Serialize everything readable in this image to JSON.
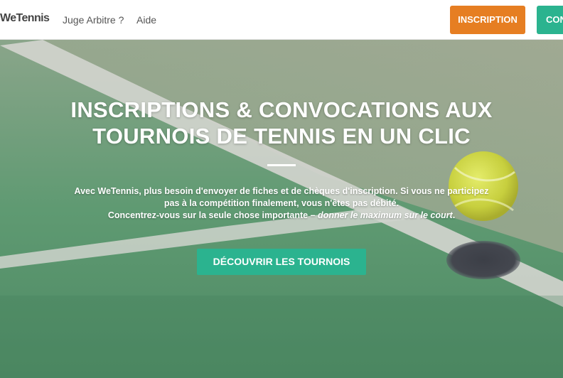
{
  "navbar": {
    "brand": "WeTennis",
    "links": [
      "Juge Arbitre ?",
      "Aide"
    ],
    "inscription_label": "INSCRIPTION",
    "connexion_label": "CONNEXION"
  },
  "hero": {
    "title_line1": "INSCRIPTIONS & CONVOCATIONS AUX",
    "title_line2": "TOURNOIS DE TENNIS EN UN CLIC",
    "text_line1": "Avec WeTennis, plus besoin d'envoyer de fiches et de chèques d'inscription. Si vous ne participez",
    "text_line2": "pas à la compétition finalement, vous n'êtes pas débité.",
    "text_line3_plain": "Concentrez-vous sur la seule chose importante – ",
    "text_line3_emphasis": "donner le maximum sur le court",
    "text_line3_end": ".",
    "cta_label": "DÉCOUVRIR LES TOURNOIS"
  },
  "colors": {
    "orange": "#e67e22",
    "green": "#2bb38f"
  }
}
